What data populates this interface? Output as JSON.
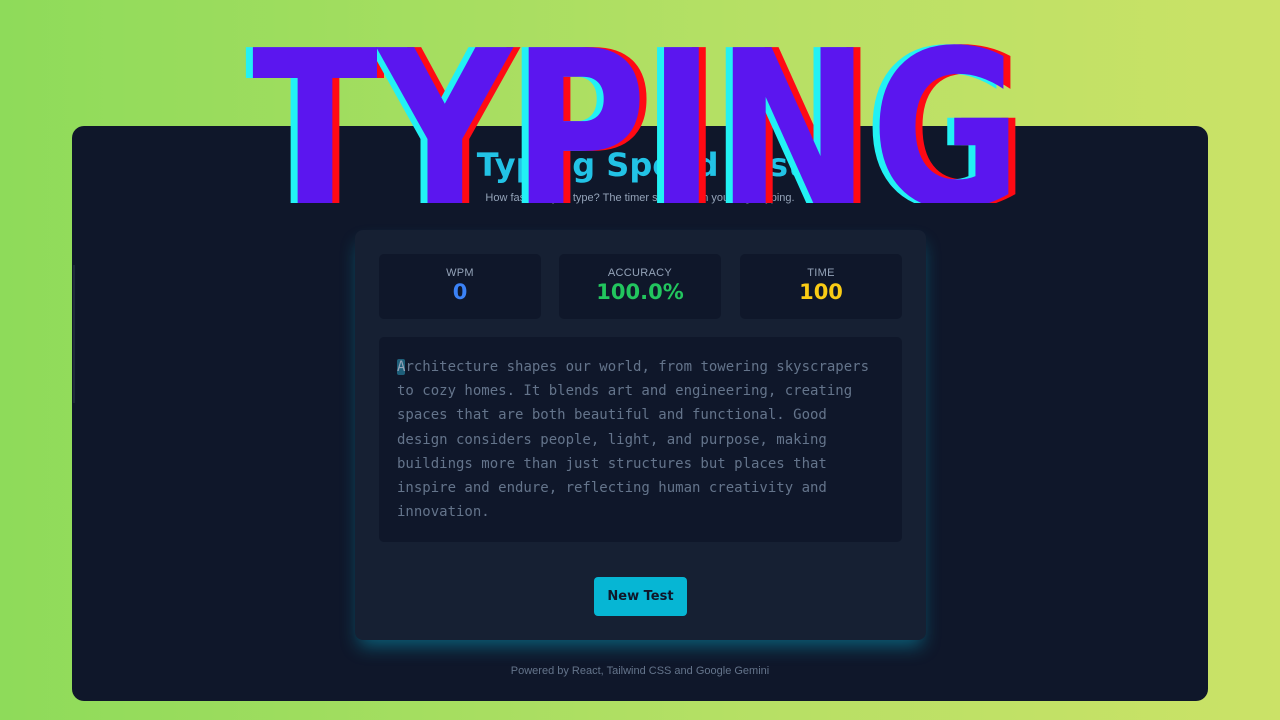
{
  "app": {
    "title": "Typing Speed Test",
    "subtitle": "How fast can you type? The timer starts when you begin typing."
  },
  "stats": [
    {
      "label": "WPM",
      "value": "0",
      "color": "#3b82f6"
    },
    {
      "label": "ACCURACY",
      "value": "100.0%",
      "color": "#22c55e"
    },
    {
      "label": "TIME",
      "value": "100",
      "color": "#facc15"
    }
  ],
  "passage": {
    "current_char": "A",
    "remaining": "rchitecture shapes our world, from towering skyscrapers\nto cozy homes. It blends art and engineering, creating\nspaces that are both beautiful and functional. Good\ndesign considers people, light, and purpose, making\nbuildings more than just structures but places that\ninspire and endure, reflecting human creativity and\ninnovation."
  },
  "buttons": {
    "new_test": "New Test"
  },
  "footer": {
    "credit": "Powered by React, Tailwind CSS and Google Gemini"
  },
  "overlay": {
    "word": "TYPING",
    "fill": "#5b16ef",
    "shadow_cyan": "#22f1f4",
    "shadow_red": "#ff0a14"
  }
}
